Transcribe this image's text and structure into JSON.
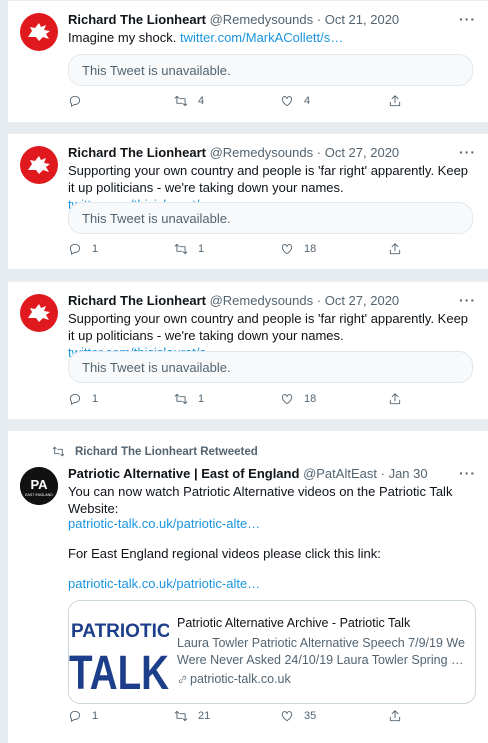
{
  "tweets": [
    {
      "name": "Richard The Lionheart",
      "handle": "@Remedysounds",
      "sep": "·",
      "date": "Oct 21, 2020",
      "more": "···",
      "text": "Imagine my shock. ",
      "link": "twitter.com/MarkACollett/s…",
      "quoted": "This Tweet is unavailable.",
      "replies": "",
      "retweets": "4",
      "likes": "4"
    },
    {
      "name": "Richard The Lionheart",
      "handle": "@Remedysounds",
      "sep": "·",
      "date": "Oct 27, 2020",
      "more": "···",
      "text": "Supporting your own country and  people is 'far right' apparently. Keep it up politicians - we're taking down your names. ",
      "link": "twitter.com/thisislaurat/s…",
      "quoted": "This Tweet is unavailable.",
      "replies": "1",
      "retweets": "1",
      "likes": "18"
    },
    {
      "name": "Richard The Lionheart",
      "handle": "@Remedysounds",
      "sep": "·",
      "date": "Oct 27, 2020",
      "more": "···",
      "text": "Supporting your own country and  people is 'far right' apparently. Keep it up politicians - we're taking down your names. ",
      "link": "twitter.com/thisislaurat/s…",
      "quoted": "This Tweet is unavailable.",
      "replies": "1",
      "retweets": "1",
      "likes": "18"
    }
  ],
  "retweet": {
    "retweeted_by": "Richard The Lionheart Retweeted",
    "name": "Patriotic Alternative | East of England",
    "handle": "@PatAltEast",
    "sep": "·",
    "date": "Jan 30",
    "more": "···",
    "avatar_text": "PA",
    "avatar_sub": "EAST ENGLAND",
    "line1": "You can now watch Patriotic Alternative videos on the Patriotic Talk Website:",
    "link1": "patriotic-talk.co.uk/patriotic-alte…",
    "line2": "For East England regional videos please click this link:",
    "link2": "patriotic-talk.co.uk/patriotic-alte…",
    "card": {
      "image_text_top": "PATRIOTIC",
      "image_text_bottom": "TALK",
      "title": "Patriotic Alternative Archive - Patriotic Talk",
      "description": "Laura Towler Patriotic Alternative Speech 7/9/19 We Were Never Asked 24/10/19 Laura Towler Spring …",
      "domain": "patriotic-talk.co.uk"
    },
    "replies": "1",
    "retweets": "21",
    "likes": "35"
  },
  "colors": {
    "link": "#1b95e0",
    "avatar_red": "#e0191f",
    "card_blue": "#1d3e8a"
  }
}
